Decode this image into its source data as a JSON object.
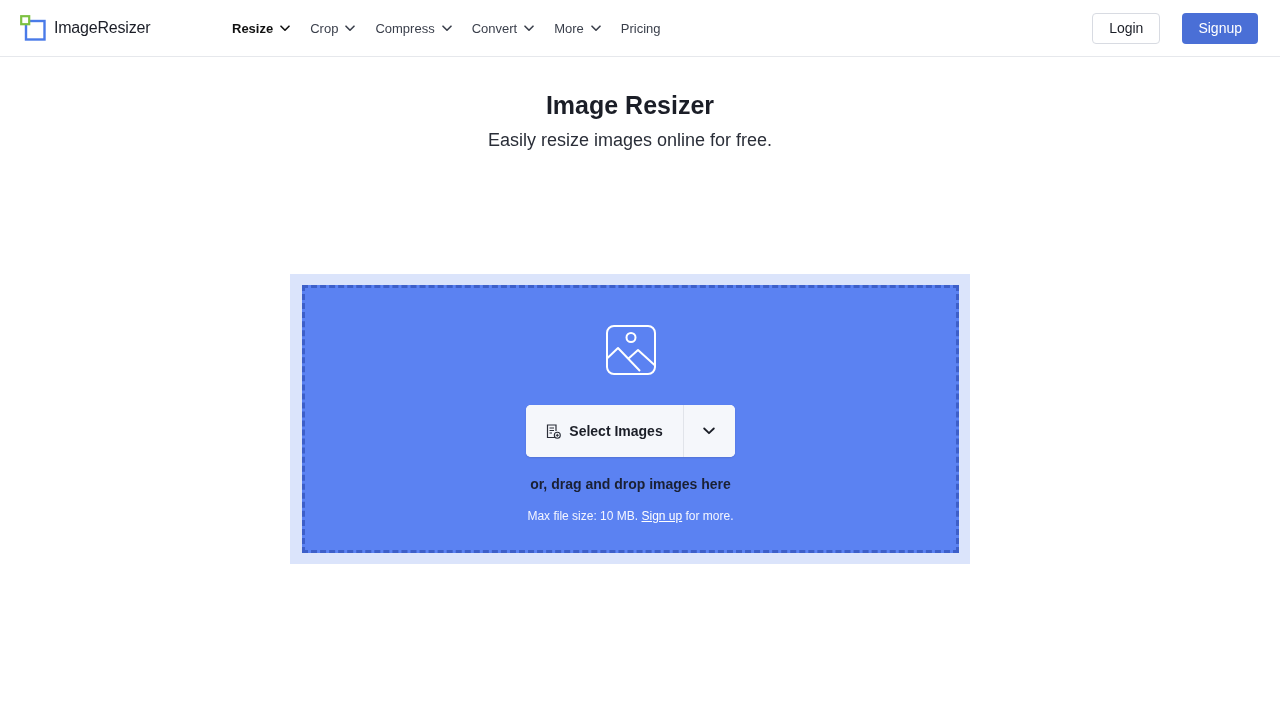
{
  "header": {
    "logo": "ImageResizer",
    "nav": [
      {
        "label": "Resize",
        "selected": true,
        "dropdown": true
      },
      {
        "label": "Crop",
        "selected": false,
        "dropdown": true
      },
      {
        "label": "Compress",
        "selected": false,
        "dropdown": true
      },
      {
        "label": "Convert",
        "selected": false,
        "dropdown": true
      },
      {
        "label": "More",
        "selected": false,
        "dropdown": true
      },
      {
        "label": "Pricing",
        "selected": false,
        "dropdown": false
      }
    ],
    "login": "Login",
    "signup": "Signup"
  },
  "hero": {
    "title": "Image Resizer",
    "subtitle": "Easily resize images online for free."
  },
  "upload": {
    "button": "Select Images",
    "drop_hint": "or, drag and drop images here",
    "limit_before": "Max file size: 10 MB.",
    "limit_link": "Sign up",
    "limit_after": "for more."
  }
}
